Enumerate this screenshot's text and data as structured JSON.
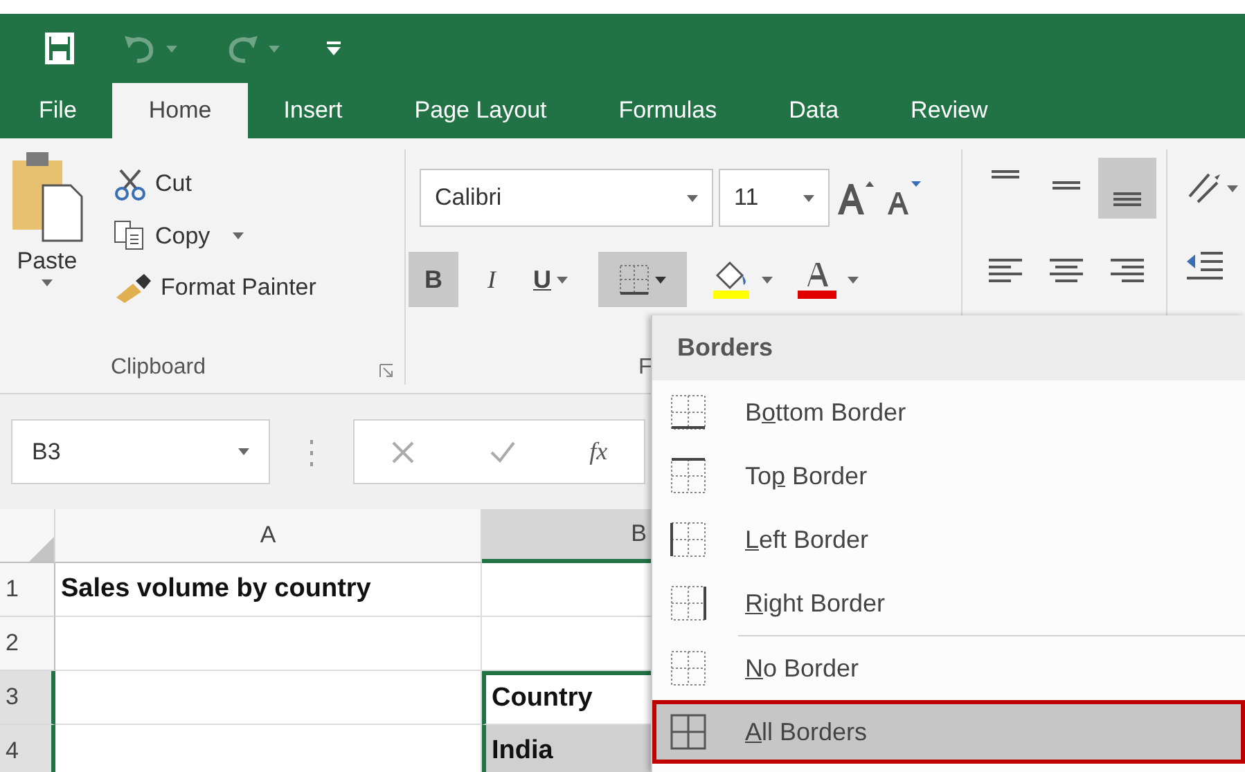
{
  "quick_access": [
    {
      "kind": "save",
      "disabled": false
    },
    {
      "kind": "undo",
      "disabled": true
    },
    {
      "kind": "redo",
      "disabled": true
    },
    {
      "kind": "customize",
      "disabled": false
    }
  ],
  "tabs": [
    {
      "label": "File",
      "selected": false
    },
    {
      "label": "Home",
      "selected": true
    },
    {
      "label": "Insert",
      "selected": false
    },
    {
      "label": "Page Layout",
      "selected": false
    },
    {
      "label": "Formulas",
      "selected": false
    },
    {
      "label": "Data",
      "selected": false
    },
    {
      "label": "Review",
      "selected": false
    }
  ],
  "clipboard": {
    "paste": "Paste",
    "cut": "Cut",
    "copy": "Copy",
    "format_painter": "Format Painter",
    "label": "Clipboard"
  },
  "font": {
    "name": "Calibri",
    "size": "11",
    "label": "F",
    "borders_pressed": true,
    "buttons": [
      {
        "kind": "bold",
        "label": "B",
        "pressed": true
      },
      {
        "kind": "italic",
        "label": "I",
        "pressed": false
      },
      {
        "kind": "underline",
        "label": "U",
        "pressed": false
      }
    ],
    "colors": [
      {
        "kind": "fill",
        "color": "#ffff00"
      },
      {
        "kind": "text",
        "color": "#e00000"
      }
    ]
  },
  "alignment": [
    {
      "kind": "top",
      "pressed": false
    },
    {
      "kind": "middle",
      "pressed": false
    },
    {
      "kind": "bottom",
      "pressed": true
    },
    {
      "kind": "left",
      "pressed": false
    },
    {
      "kind": "center",
      "pressed": false
    },
    {
      "kind": "right",
      "pressed": false
    }
  ],
  "name_box": "B3",
  "formula_bar": {
    "function_label": "fx"
  },
  "sheet": {
    "columns": [
      {
        "label": "A",
        "selected": false
      },
      {
        "label": "B",
        "selected": true
      }
    ],
    "rows": [
      {
        "header": "1",
        "selected": false,
        "cells": [
          {
            "text": "Sales volume by country",
            "selected": false,
            "active": false
          },
          {
            "selected": false,
            "active": false
          }
        ]
      },
      {
        "header": "2",
        "selected": false,
        "cells": [
          {
            "selected": false,
            "active": false
          },
          {
            "selected": false,
            "active": false
          }
        ]
      },
      {
        "header": "3",
        "selected": true,
        "cells": [
          {
            "selected": false,
            "active": false
          },
          {
            "text": "Country",
            "selected": true,
            "active": true
          }
        ]
      },
      {
        "header": "4",
        "selected": true,
        "cells": [
          {
            "selected": false,
            "active": false
          },
          {
            "text": "India",
            "selected": true,
            "active": false
          }
        ]
      }
    ]
  },
  "borders_menu": {
    "title": "Borders",
    "items": [
      {
        "kind": "bottom",
        "before": "B",
        "key": "o",
        "after": "ttom Border",
        "separator_before": false,
        "selected": false
      },
      {
        "kind": "top",
        "before": "To",
        "key": "p",
        "after": " Border",
        "separator_before": false,
        "selected": false
      },
      {
        "kind": "left",
        "key": "L",
        "after": "eft Border",
        "separator_before": false,
        "selected": false
      },
      {
        "kind": "right",
        "key": "R",
        "after": "ight Border",
        "separator_before": false,
        "selected": false
      },
      {
        "kind": "none",
        "key": "N",
        "after": "o Border",
        "separator_before": true,
        "selected": false
      },
      {
        "kind": "all",
        "key": "A",
        "after": "ll Borders",
        "separator_before": false,
        "selected": true
      }
    ]
  }
}
